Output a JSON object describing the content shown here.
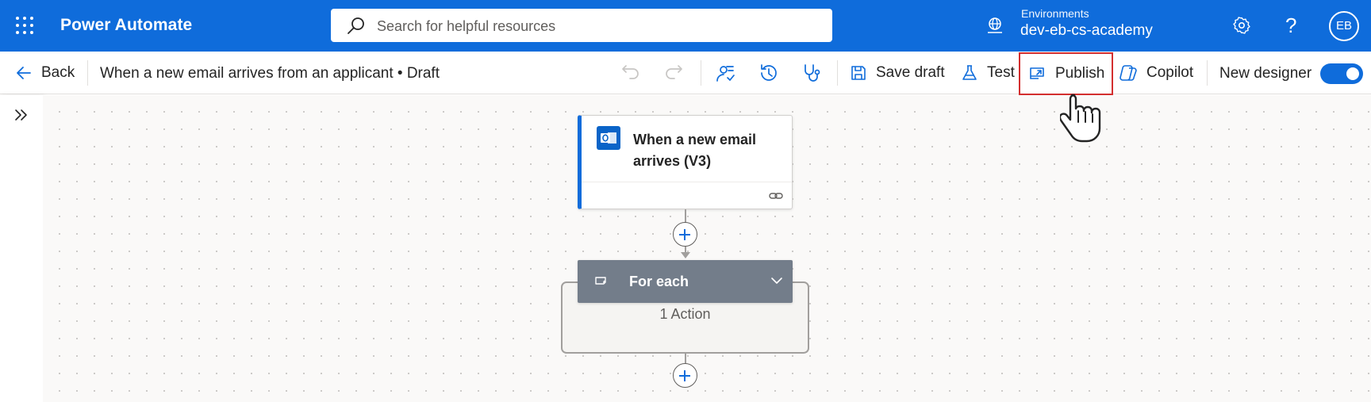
{
  "header": {
    "app_title": "Power Automate",
    "search_placeholder": "Search for helpful resources",
    "environment_label": "Environments",
    "environment_name": "dev-eb-cs-academy",
    "help_glyph": "?",
    "avatar_initials": "EB",
    "brand_color": "#0f6cdb"
  },
  "commandbar": {
    "back_label": "Back",
    "flow_title": "When a new email arrives from an applicant • Draft",
    "save_draft_label": "Save draft",
    "test_label": "Test",
    "publish_label": "Publish",
    "copilot_label": "Copilot",
    "new_designer_label": "New designer",
    "new_designer_enabled": true,
    "icons": [
      "undo-icon",
      "redo-icon",
      "flow-checker-icon",
      "version-history-icon",
      "stethoscope-icon",
      "save-icon",
      "flask-icon",
      "publish-icon",
      "copilot-icon"
    ]
  },
  "canvas": {
    "trigger": {
      "title": "When a new email arrives (V3)",
      "icon": "outlook-icon"
    },
    "foreach": {
      "title": "For each",
      "action_count": "1 Action",
      "icon": "loop-icon",
      "color": "#737d8a"
    }
  },
  "highlight": {
    "target": "publish-button",
    "color": "#d32f2f"
  }
}
